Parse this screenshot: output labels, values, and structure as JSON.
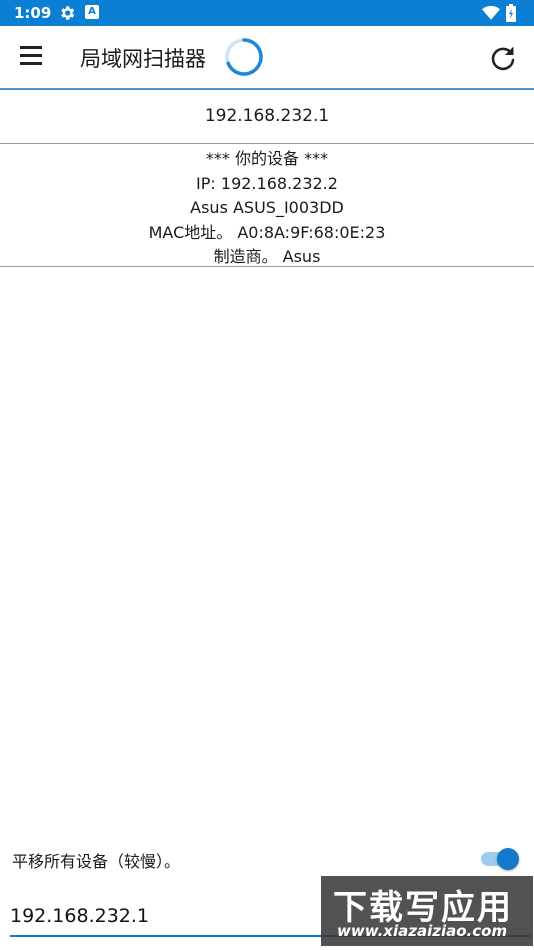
{
  "status_bar": {
    "time": "1:09",
    "icons": [
      "gear-icon",
      "a-icon",
      "wifi-icon",
      "battery-charging-icon"
    ],
    "notification_letter": "A"
  },
  "app_bar": {
    "title": "局域网扫描器",
    "menu_icon": "hamburger-menu-icon",
    "refresh_icon": "refresh-icon",
    "accent_color": "#0a7fd3"
  },
  "devices": {
    "gateway": {
      "ip": "192.168.232.1"
    },
    "your_device": {
      "header": "*** 你的设备 ***",
      "ip_line": "IP: 192.168.232.2",
      "name_line": "Asus ASUS_I003DD",
      "mac_line": "MAC地址。 A0:8A:9F:68:0E:23",
      "vendor_line": "制造商。 Asus"
    }
  },
  "footer": {
    "pan_label": "平移所有设备（较慢）。",
    "pan_enabled": true,
    "ip_input_value": "192.168.232.1"
  },
  "watermark": {
    "main": "下载写应用",
    "url": "www.xiazaiziao.com"
  }
}
